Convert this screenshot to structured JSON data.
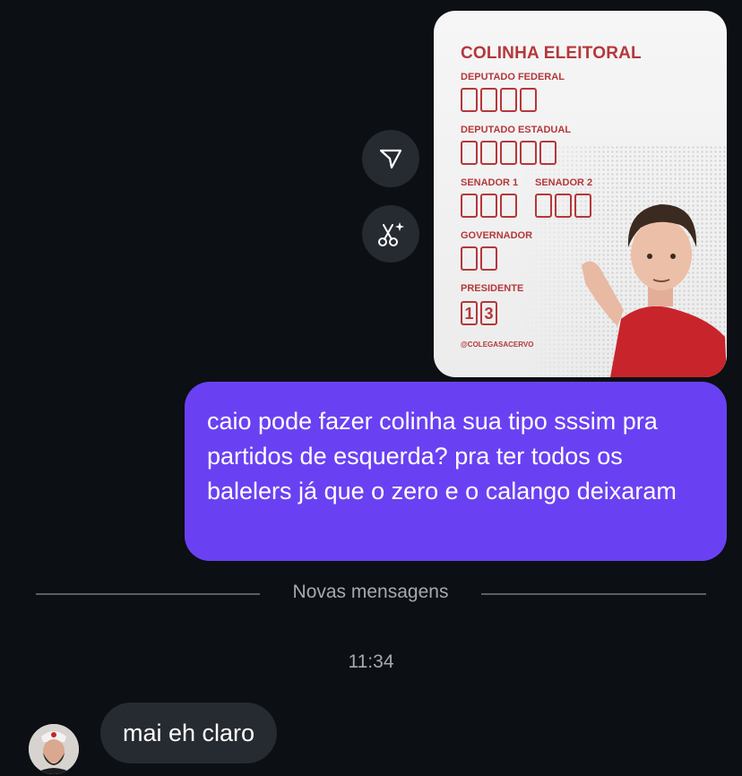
{
  "actions": {
    "share_icon": "paper-plane-icon",
    "remix_icon": "scissors-sparkle-icon"
  },
  "image_card": {
    "title": "COLINHA ELEITORAL",
    "sections": {
      "deputado_federal": {
        "label": "DEPUTADO FEDERAL",
        "digits": [
          "",
          "",
          "",
          ""
        ]
      },
      "deputado_estadual": {
        "label": "DEPUTADO ESTADUAL",
        "digits": [
          "",
          "",
          "",
          "",
          ""
        ]
      },
      "senador_1": {
        "label": "SENADOR 1",
        "digits": [
          "",
          "",
          ""
        ]
      },
      "senador_2": {
        "label": "SENADOR 2",
        "digits": [
          "",
          "",
          ""
        ]
      },
      "governador": {
        "label": "GOVERNADOR",
        "digits": [
          "",
          ""
        ]
      },
      "presidente": {
        "label": "PRESIDENTE",
        "digits": [
          "1",
          "3"
        ]
      }
    },
    "handle": "@COLEGASACERVO"
  },
  "messages": {
    "outgoing_text": "caio pode fazer colinha sua tipo sssim pra partidos de esquerda? pra ter todos os balelers já que o zero e o calango deixaram",
    "divider_label": "Novas mensagens",
    "timestamp": "11:34",
    "incoming_text": "mai eh claro"
  },
  "colors": {
    "background": "#0c0f14",
    "outgoing_bubble": "#6a41f2",
    "incoming_bubble": "#262a31",
    "card_accent": "#b5373a"
  }
}
